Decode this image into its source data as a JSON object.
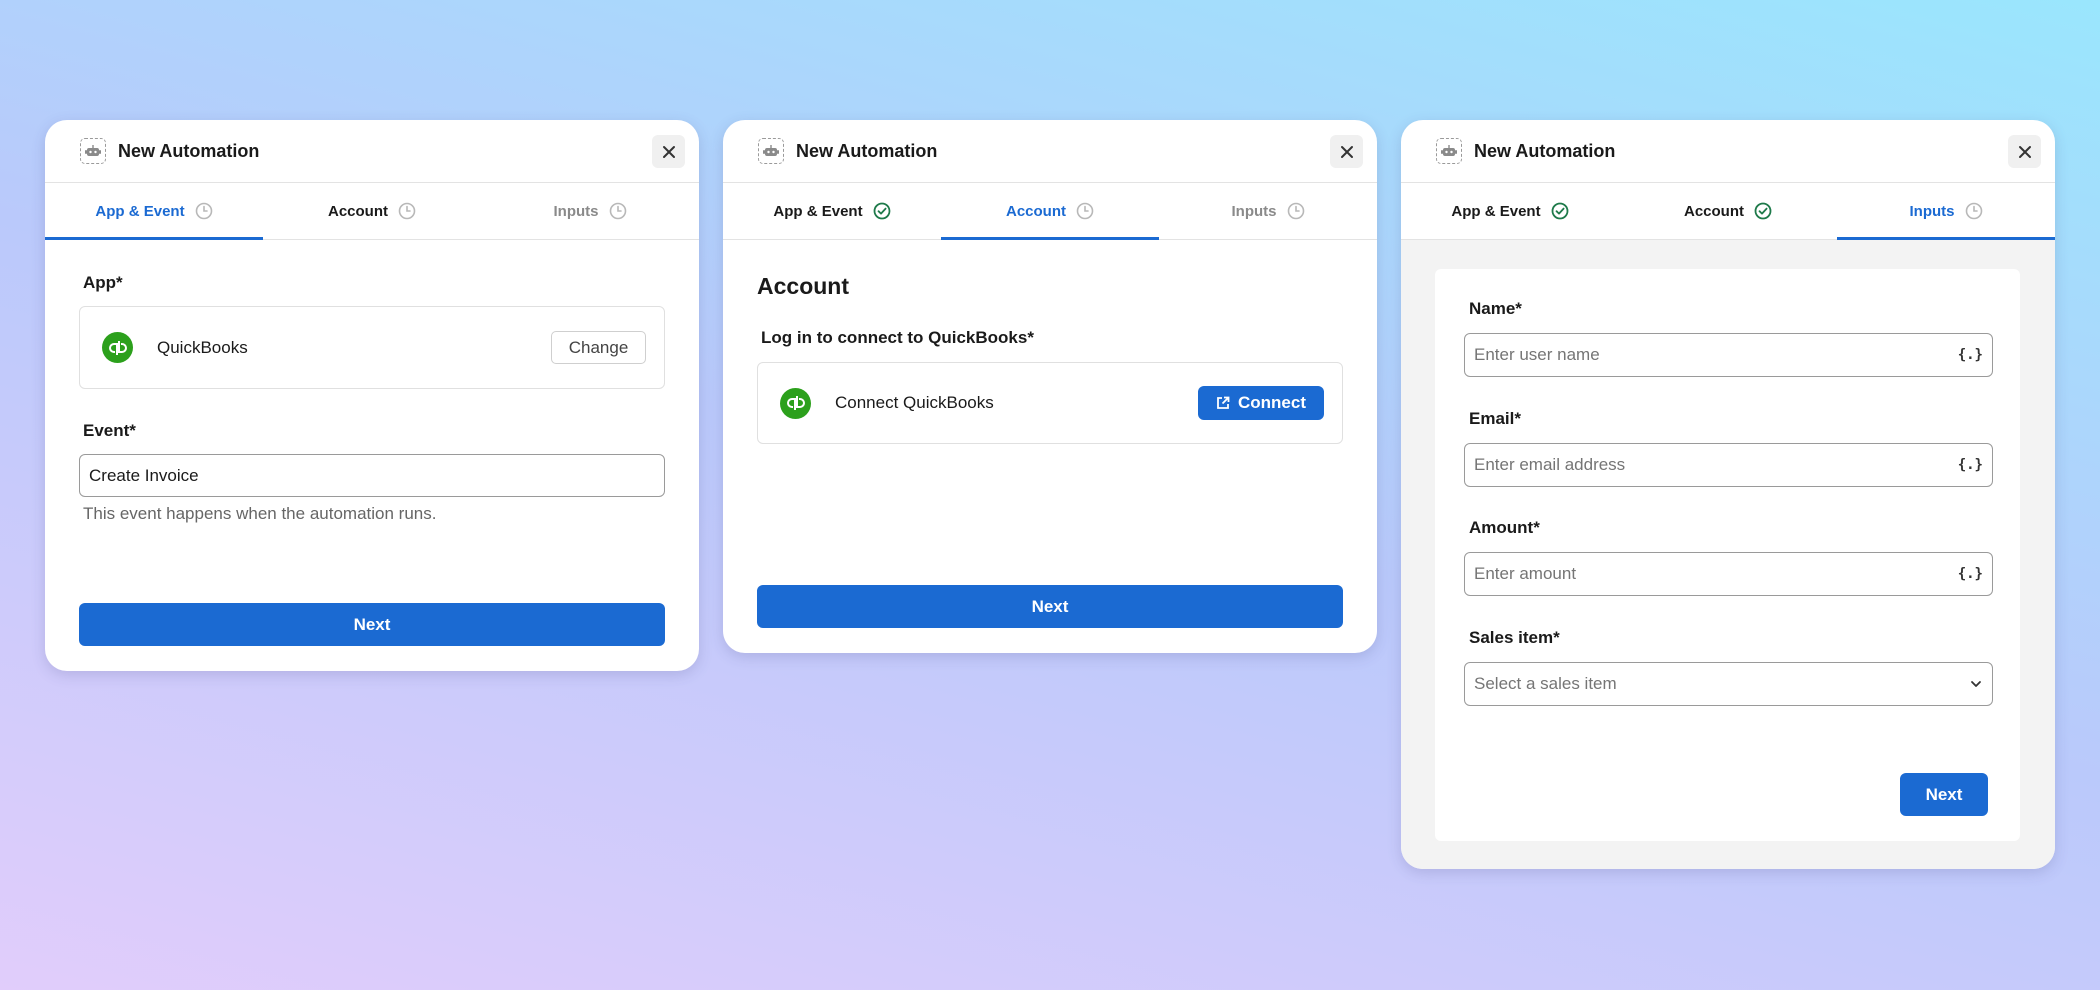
{
  "cards": [
    {
      "title": "New Automation",
      "tabs": [
        "App & Event",
        "Account",
        "Inputs"
      ],
      "app_label": "App*",
      "app_name": "QuickBooks",
      "change_label": "Change",
      "event_label": "Event*",
      "event_value": "Create Invoice",
      "event_help": "This event happens when the automation runs.",
      "next_label": "Next"
    },
    {
      "title": "New Automation",
      "tabs": [
        "App & Event",
        "Account",
        "Inputs"
      ],
      "heading": "Account",
      "login_label": "Log in to connect to QuickBooks*",
      "connect_text": "Connect QuickBooks",
      "connect_button": "Connect",
      "next_label": "Next"
    },
    {
      "title": "New Automation",
      "tabs": [
        "App & Event",
        "Account",
        "Inputs"
      ],
      "fields": [
        {
          "label": "Name*",
          "placeholder": "Enter user name",
          "suffix": "{.}"
        },
        {
          "label": "Email*",
          "placeholder": "Enter email address",
          "suffix": "{.}"
        },
        {
          "label": "Amount*",
          "placeholder": "Enter amount",
          "suffix": "{.}"
        },
        {
          "label": "Sales item*",
          "placeholder": "Select a sales item"
        }
      ],
      "next_label": "Next"
    }
  ],
  "colors": {
    "primary": "#1b6ad2",
    "success": "#1e7a4a",
    "pending": "#b8b8b8",
    "quickbooks": "#2ca01c"
  },
  "icons": {
    "header": "robot-icon",
    "close": "close-icon",
    "pending": "clock-icon",
    "done": "check-circle-icon",
    "external": "external-link-icon",
    "dropdown": "chevron-down-icon"
  }
}
